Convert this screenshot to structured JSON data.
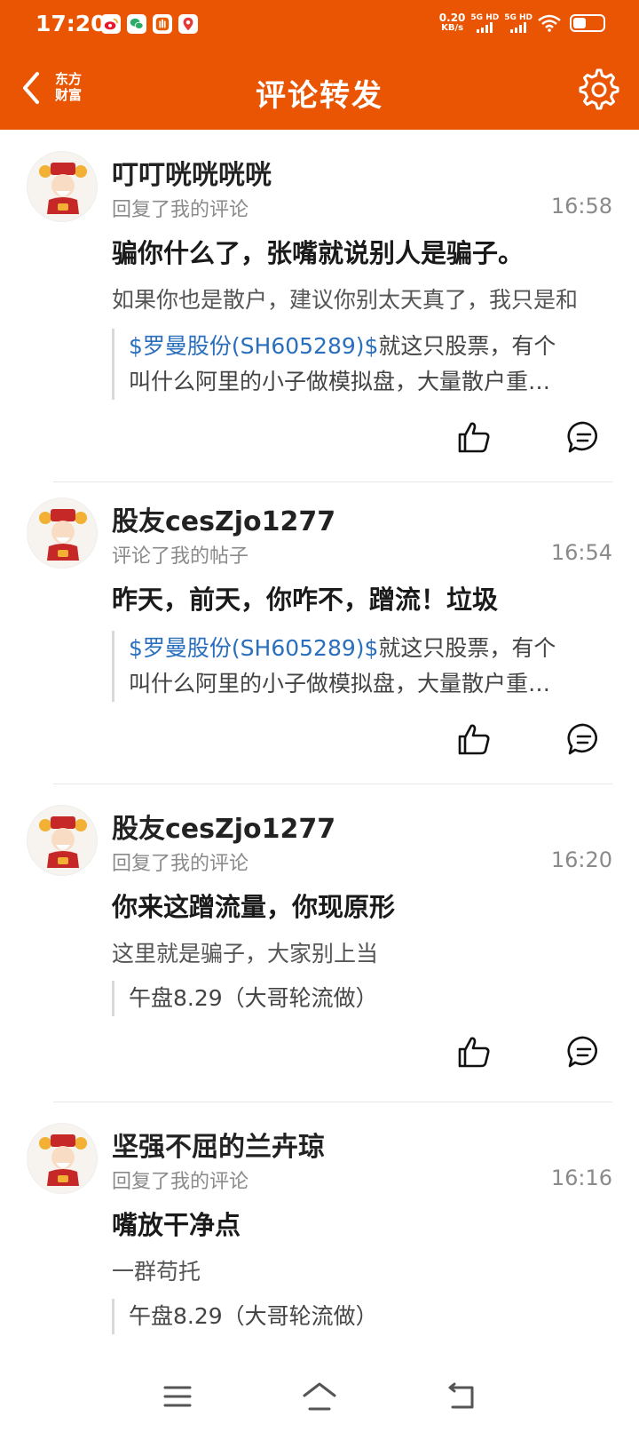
{
  "status_bar": {
    "time": "17:20",
    "net_speed_value": "0.20",
    "net_speed_unit": "KB/s",
    "signal1_label": "5G HD",
    "signal2_label": "5G HD",
    "battery_level": 0.45
  },
  "nav": {
    "logo_line1": "东方",
    "logo_line2": "财富",
    "title": "评论转发",
    "back_icon": "chevron-left-icon",
    "settings_icon": "gear-icon"
  },
  "colors": {
    "brand": "#ea5504",
    "stock_link": "#2a6fbd"
  },
  "items": [
    {
      "user": "叮叮咣咣咣咣",
      "action": "回复了我的评论",
      "time": "16:58",
      "reply": "骗你什么了，张嘴就说别人是骗子。",
      "original": "如果你也是散户，建议你别太天真了，我只是和",
      "quote_stock": "$罗曼股份(SH605289)$",
      "quote_rest": "就这只股票，有个",
      "quote_line2": "叫什么阿里的小子做模拟盘，大量散户重…"
    },
    {
      "user": "股友cesZjo1277",
      "action": "评论了我的帖子",
      "time": "16:54",
      "reply": "昨天，前天，你咋不，蹭流！垃圾",
      "quote_stock": "$罗曼股份(SH605289)$",
      "quote_rest": "就这只股票，有个",
      "quote_line2": "叫什么阿里的小子做模拟盘，大量散户重…"
    },
    {
      "user": "股友cesZjo1277",
      "action": "回复了我的评论",
      "time": "16:20",
      "reply": "你来这蹭流量，你现原形",
      "original": "这里就是骗子，大家别上当",
      "quote_text": "午盘8.29（大哥轮流做）"
    },
    {
      "user": "坚强不屈的兰卉琼",
      "action": "回复了我的评论",
      "time": "16:16",
      "reply": "嘴放干净点",
      "original": "一群苟托",
      "quote_text": "午盘8.29（大哥轮流做）"
    }
  ],
  "bottom_nav": {
    "menu_icon": "menu-icon",
    "home_icon": "home-icon",
    "back_icon": "back-arrow-icon"
  }
}
